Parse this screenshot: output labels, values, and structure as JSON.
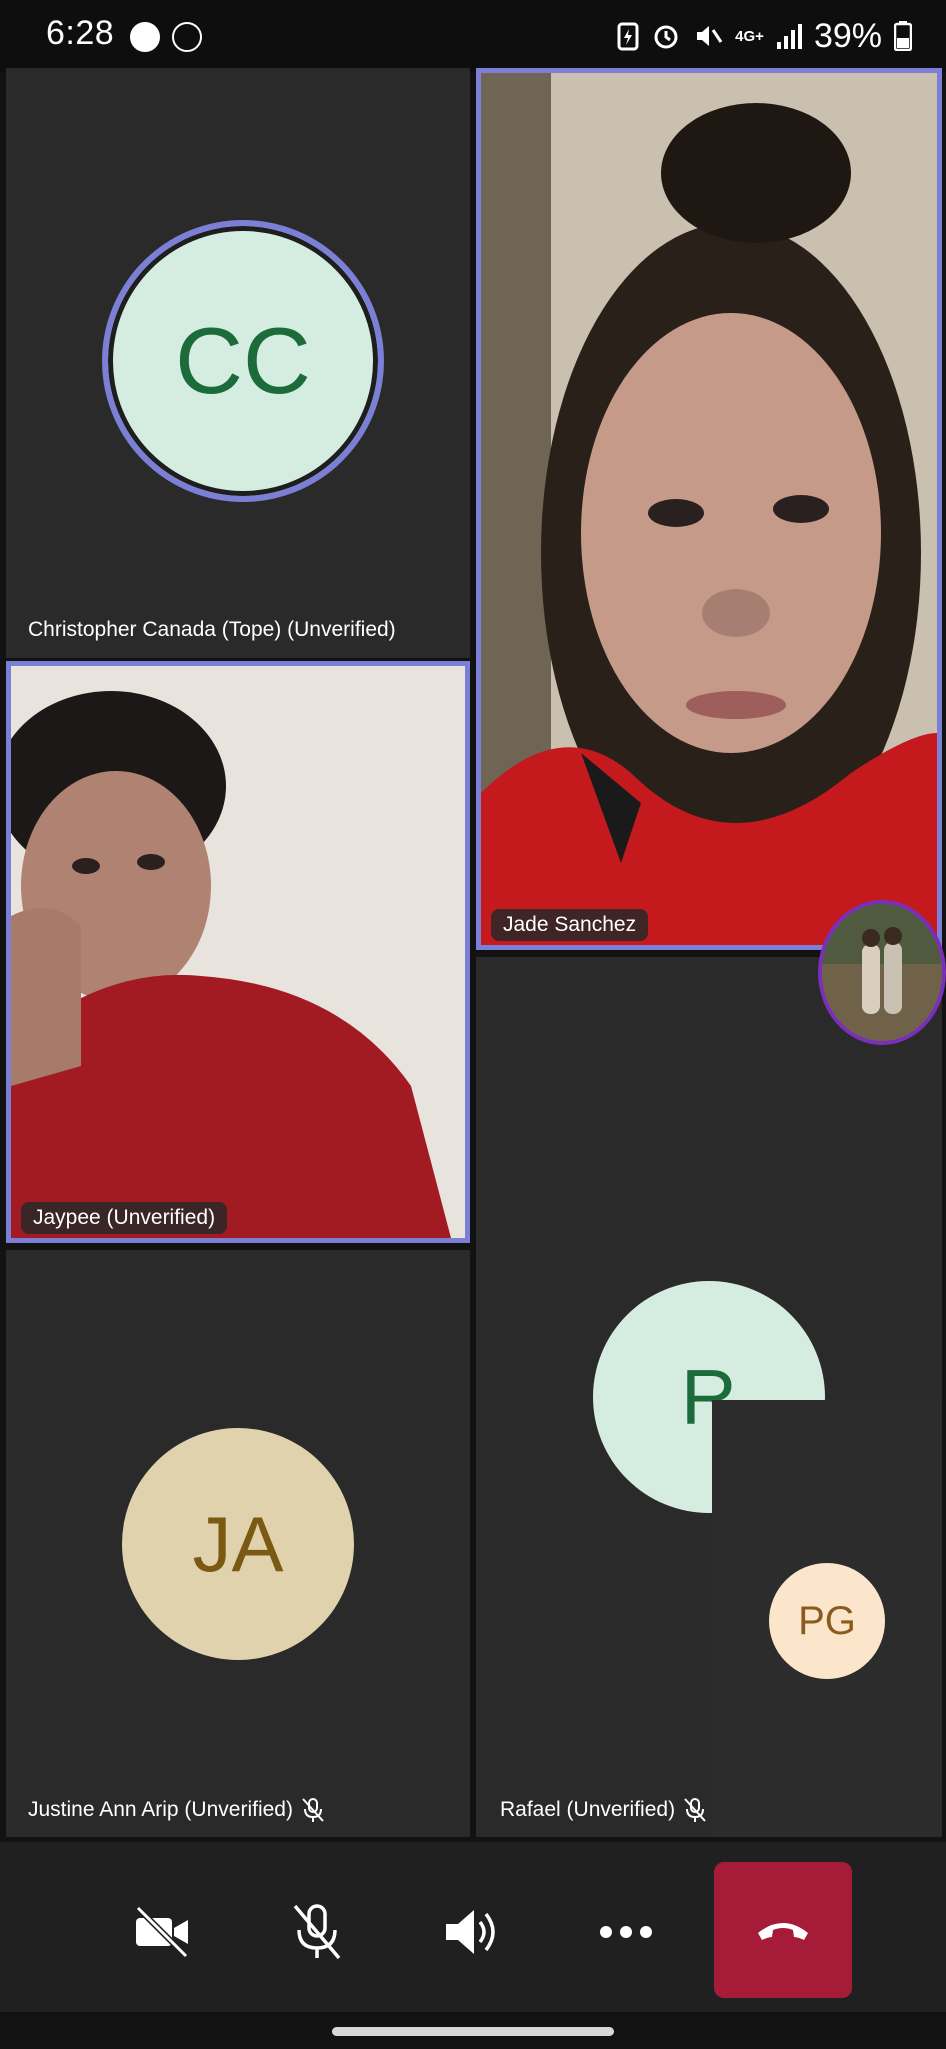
{
  "status_bar": {
    "time": "6:28",
    "battery": "39%",
    "network": "4G+"
  },
  "participants": {
    "christopher": {
      "initials": "CC",
      "name": "Christopher Canada (Tope) (Unverified)"
    },
    "jade": {
      "name": "Jade Sanchez"
    },
    "jaypee": {
      "name": "Jaypee (Unverified)"
    },
    "justine": {
      "initials": "JA",
      "name": "Justine Ann Arip (Unverified)"
    },
    "rafael": {
      "initials": "R",
      "name": "Rafael (Unverified)"
    },
    "self": {
      "initials": "PG"
    }
  },
  "colors": {
    "active_border": "#7b7fd6",
    "tile_bg": "#2a2a2a",
    "avatar_green": "#d5ede0",
    "avatar_green_text": "#1c6b3a",
    "avatar_tan": "#e0d2ad",
    "avatar_tan_text": "#7a5a12",
    "avatar_peach": "#fbe6cc",
    "avatar_peach_text": "#8a5a1e",
    "hangup": "#a61b38"
  },
  "controls": {
    "camera": "camera-off-icon",
    "mic": "mic-muted-icon",
    "speaker": "speaker-icon",
    "more": "more-icon",
    "hangup": "hang-up-icon"
  }
}
